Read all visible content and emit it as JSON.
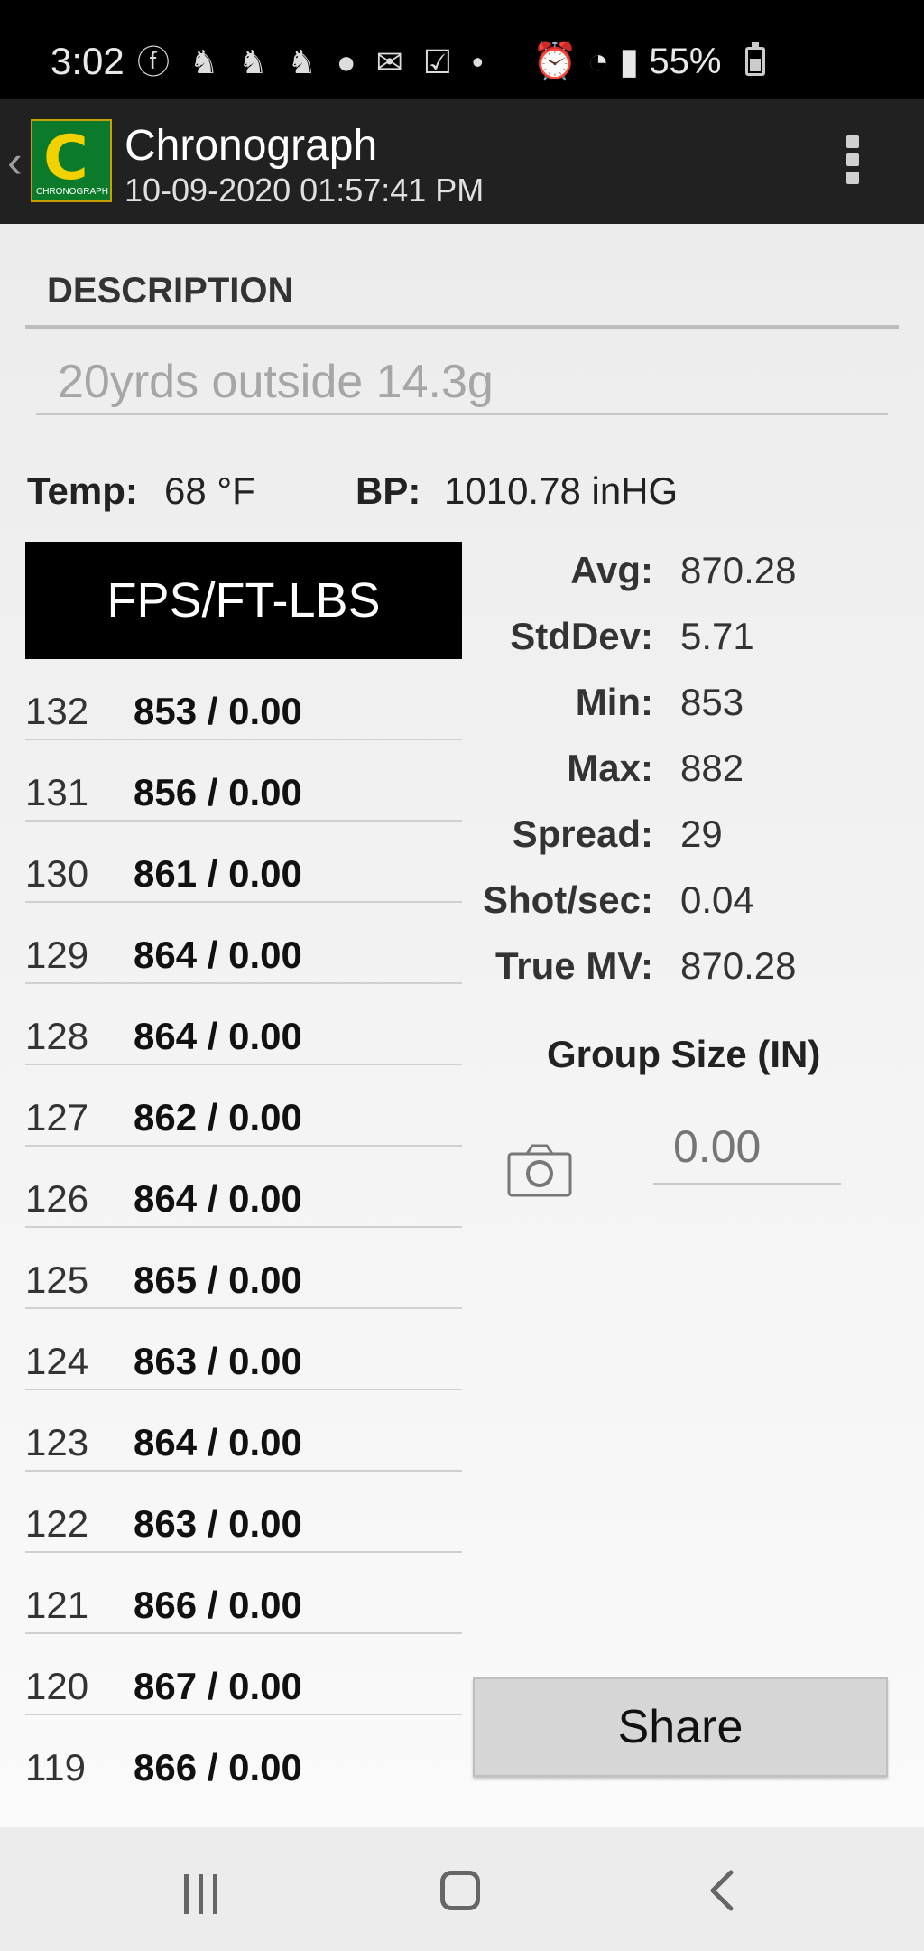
{
  "status_bar": {
    "time": "3:02",
    "notification_icons": [
      "facebook-icon",
      "bird-icon",
      "bird-icon",
      "bird-icon",
      "account-icon",
      "gmail-icon",
      "checkbox-icon",
      "dot-icon"
    ],
    "right_text": "55%",
    "battery_level": 0.55
  },
  "app_bar": {
    "title": "Chronograph",
    "subtitle": "10-09-2020 01:57:41 PM",
    "logo_letter": "C",
    "logo_word": "CHRONOGRAPH"
  },
  "description": {
    "heading": "DESCRIPTION",
    "value": "20yrds outside 14.3g"
  },
  "environment": {
    "temp_label": "Temp:",
    "temp_value": "68 °F",
    "bp_label": "BP:",
    "bp_value": "1010.78 inHG"
  },
  "shots": {
    "header": "FPS/FT-LBS",
    "rows": [
      {
        "num": "132",
        "value": "853 / 0.00"
      },
      {
        "num": "131",
        "value": "856 / 0.00"
      },
      {
        "num": "130",
        "value": "861 / 0.00"
      },
      {
        "num": "129",
        "value": "864 / 0.00"
      },
      {
        "num": "128",
        "value": "864 / 0.00"
      },
      {
        "num": "127",
        "value": "862 / 0.00"
      },
      {
        "num": "126",
        "value": "864 / 0.00"
      },
      {
        "num": "125",
        "value": "865 / 0.00"
      },
      {
        "num": "124",
        "value": "863 / 0.00"
      },
      {
        "num": "123",
        "value": "864 / 0.00"
      },
      {
        "num": "122",
        "value": "863 / 0.00"
      },
      {
        "num": "121",
        "value": "866 / 0.00"
      },
      {
        "num": "120",
        "value": "867 / 0.00"
      },
      {
        "num": "119",
        "value": "866 / 0.00"
      }
    ]
  },
  "stats": [
    {
      "label": "Avg:",
      "value": "870.28"
    },
    {
      "label": "StdDev:",
      "value": "5.71"
    },
    {
      "label": "Min:",
      "value": "853"
    },
    {
      "label": "Max:",
      "value": "882"
    },
    {
      "label": "Spread:",
      "value": "29"
    },
    {
      "label": "Shot/sec:",
      "value": "0.04"
    },
    {
      "label": "True MV:",
      "value": "870.28"
    }
  ],
  "group": {
    "label": "Group Size (IN)",
    "placeholder": "0.00",
    "camera_icon": "camera-icon"
  },
  "share_label": "Share",
  "nav": {
    "icons": [
      "recents-icon",
      "home-icon",
      "back-icon"
    ]
  }
}
